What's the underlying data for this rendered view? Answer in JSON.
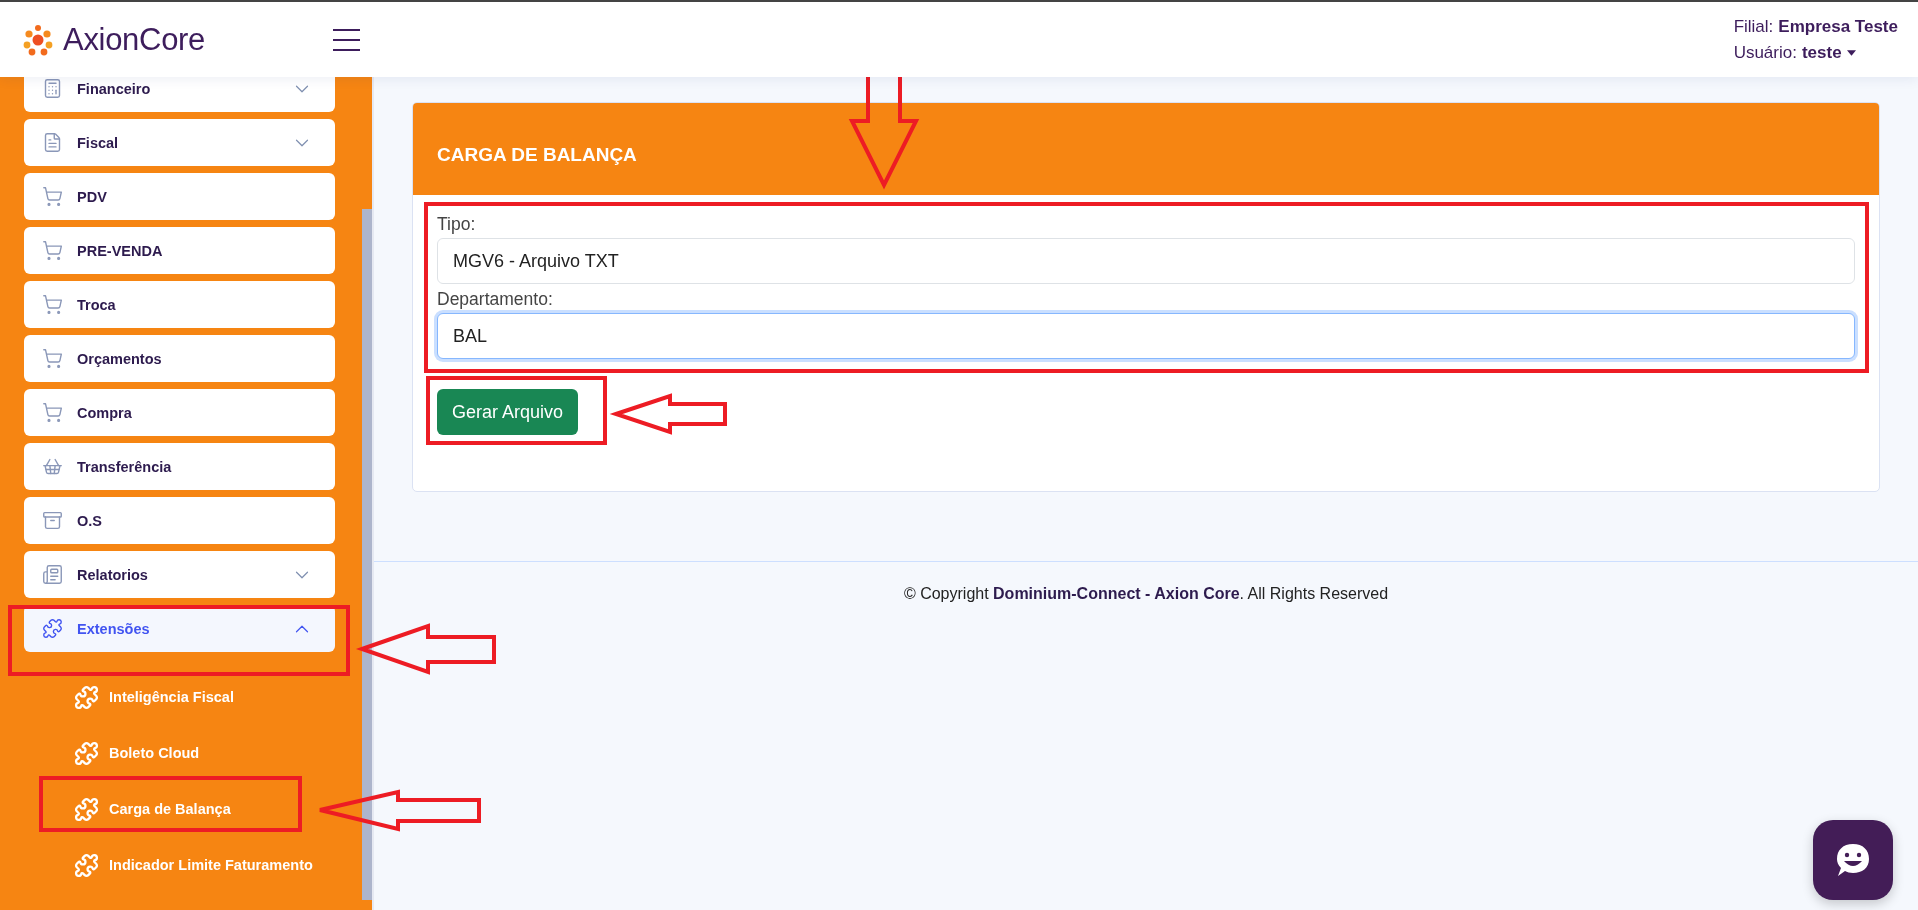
{
  "header": {
    "brand": "AxionCore",
    "branch_label": "Filial:",
    "branch": "Empresa Teste",
    "user_label": "Usuário:",
    "user": "teste"
  },
  "sidebar": {
    "items": [
      {
        "label": "Financeiro",
        "kind": "group",
        "expanded": false,
        "selected": false
      },
      {
        "label": "Fiscal",
        "kind": "group",
        "expanded": false,
        "selected": false
      },
      {
        "label": "PDV",
        "kind": "link",
        "selected": false
      },
      {
        "label": "PRE-VENDA",
        "kind": "link",
        "selected": false
      },
      {
        "label": "Troca",
        "kind": "link",
        "selected": false
      },
      {
        "label": "Orçamentos",
        "kind": "link",
        "selected": false
      },
      {
        "label": "Compra",
        "kind": "link",
        "selected": false
      },
      {
        "label": "Transferência",
        "kind": "link",
        "selected": false
      },
      {
        "label": "O.S",
        "kind": "link",
        "selected": false
      },
      {
        "label": "Relatorios",
        "kind": "group",
        "expanded": false,
        "selected": false
      },
      {
        "label": "Extensões",
        "kind": "group",
        "expanded": true,
        "selected": true,
        "children": [
          {
            "label": "Inteligência Fiscal",
            "selected": false
          },
          {
            "label": "Boleto Cloud",
            "selected": false
          },
          {
            "label": "Carga de Balança",
            "selected": false
          },
          {
            "label": "Indicador Limite Faturamento",
            "selected": false
          }
        ]
      }
    ]
  },
  "card": {
    "title": "CARGA DE BALANÇA",
    "fields": [
      {
        "label": "Tipo:",
        "value": "MGV6 - Arquivo TXT",
        "focused": false
      },
      {
        "label": "Departamento:",
        "value": "BAL",
        "focused": true
      }
    ],
    "button": "Gerar Arquivo"
  },
  "footer": {
    "text": "© Copyright **Dominium-Connect - Axion Core**. All Rights Reserved"
  }
}
